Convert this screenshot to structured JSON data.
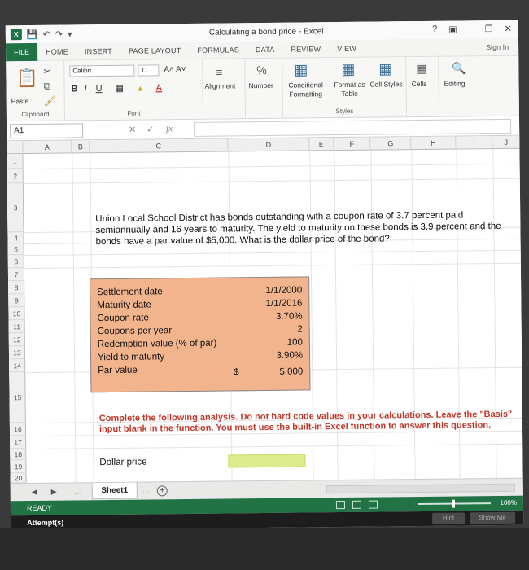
{
  "window": {
    "title": "Calculating a bond price - Excel",
    "signin": "Sign In"
  },
  "menu": {
    "file": "FILE",
    "tabs": [
      "HOME",
      "INSERT",
      "PAGE LAYOUT",
      "FORMULAS",
      "DATA",
      "REVIEW",
      "VIEW"
    ]
  },
  "ribbon": {
    "clipboard_label": "Clipboard",
    "paste": "Paste",
    "font_name": "Calibri",
    "font_size": "11",
    "font_label": "Font",
    "alignment": "Alignment",
    "number": "Number",
    "conditional": "Conditional Formatting",
    "format_table": "Format as Table",
    "cell_styles": "Cell Styles",
    "styles_label": "Styles",
    "cells": "Cells",
    "editing": "Editing"
  },
  "formula_bar": {
    "name_box": "A1",
    "fx": "fx"
  },
  "columns": [
    "A",
    "B",
    "C",
    "D",
    "E",
    "F",
    "G",
    "H",
    "I",
    "J"
  ],
  "rows": [
    "1",
    "2",
    "3",
    "4",
    "5",
    "6",
    "7",
    "8",
    "9",
    "10",
    "11",
    "12",
    "13",
    "14",
    "15",
    "16",
    "17",
    "18",
    "19",
    "20"
  ],
  "problem_text": "Union Local School District has bonds outstanding with a coupon rate of 3.7 percent paid semiannually and 16 years to maturity. The yield to maturity on these bonds is 3.9 percent and the bonds have a par value of $5,000. What is the dollar price of the bond?",
  "inputs": [
    {
      "label": "Settlement date",
      "value": "1/1/2000"
    },
    {
      "label": "Maturity date",
      "value": "1/1/2016"
    },
    {
      "label": "Coupon rate",
      "value": "3.70%"
    },
    {
      "label": "Coupons per year",
      "value": "2"
    },
    {
      "label": "Redemption value (% of par)",
      "value": "100"
    },
    {
      "label": "Yield to maturity",
      "value": "3.90%"
    },
    {
      "label": "Par value",
      "value": "5,000",
      "currency": "$"
    }
  ],
  "instructions": "Complete the following analysis. Do not hard code values in your calculations. Leave the \"Basis\" input blank in the function. You must use the built-in Excel function to answer this question.",
  "result_label": "Dollar price",
  "sheet": {
    "name": "Sheet1"
  },
  "status": {
    "ready": "READY",
    "zoom": "100%"
  },
  "attempts": {
    "label": "Attempt(s)",
    "hint": "Hint",
    "show_me": "Show Me"
  }
}
